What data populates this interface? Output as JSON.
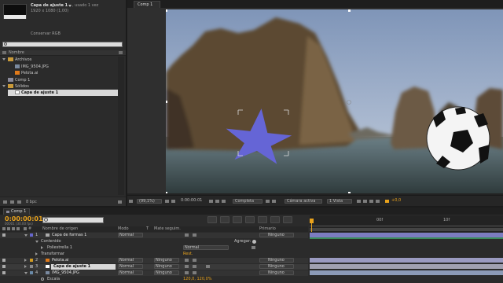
{
  "project": {
    "item_name": "Capa de ajuste 1",
    "item_usage": ", usado 1 vez",
    "item_dims": "1920 x 1080 (1,00)",
    "item_color": "Conservar RGB",
    "columns": {
      "name": "Nombre"
    },
    "folders": [
      {
        "name": "Archivos",
        "children": [
          "IMG_9504.JPG",
          "Pelota.ai"
        ]
      },
      {
        "name": "Comp 1",
        "children": []
      },
      {
        "name": "Sólidos",
        "children": [
          "Capa de ajuste 1"
        ]
      }
    ],
    "footer_bpc": "8 bpc"
  },
  "viewer": {
    "tab": "Comp 1",
    "zoom": "(99,1%)",
    "timecode": "0:00:00:01",
    "resolution": "Completa",
    "camera": "Cámara activa",
    "views": "1 Vista",
    "exposure": "+0,0"
  },
  "timeline": {
    "tab": "Comp 1",
    "timecode": "0:00:00:01",
    "fps_label": "00001 (30.00 fps)",
    "headers": {
      "name": "Nombre de origen",
      "mode": "Modo",
      "track": "T",
      "track_matte": "Mate seguim.",
      "parent": "Primario"
    },
    "layers": [
      {
        "num": "1",
        "name": "Capa de formas 1",
        "mode": "Normal",
        "matte": "",
        "parent": "Ninguno",
        "color": "#6666cc"
      },
      {
        "num": "",
        "name": "Contenido",
        "mode": "",
        "matte": "",
        "parent": "",
        "color": ""
      },
      {
        "num": "",
        "name": "Poliestrella 1",
        "mode": "Normal",
        "matte": "",
        "parent": "",
        "color": ""
      },
      {
        "num": "",
        "name": "Transformar",
        "mode": "",
        "matte": "",
        "parent": "",
        "color": ""
      },
      {
        "num": "2",
        "name": "Pelota.ai",
        "mode": "Normal",
        "matte": "Ninguno",
        "parent": "Ninguno",
        "color": "#d19b22"
      },
      {
        "num": "3",
        "name": "Capa de ajuste 1",
        "mode": "Normal",
        "matte": "Ninguno",
        "parent": "Ninguno",
        "color": "#8a8a8a"
      },
      {
        "num": "4",
        "name": "IMG_9504.JPG",
        "mode": "Normal",
        "matte": "Ninguno",
        "parent": "Ninguno",
        "color": "#6a8aa8"
      },
      {
        "num": "",
        "name": "Escala",
        "mode": "",
        "matte": "",
        "parent": "",
        "color": ""
      }
    ],
    "add_label": "Agregar:",
    "reset_label": "Rest.",
    "scale_value": "120,0, 120,0%",
    "ruler": [
      "00f",
      "10f"
    ]
  },
  "colors": {
    "accent_orange": "#e8a21c",
    "star": "#6a6ad6",
    "panel": "#2b2b2b"
  }
}
